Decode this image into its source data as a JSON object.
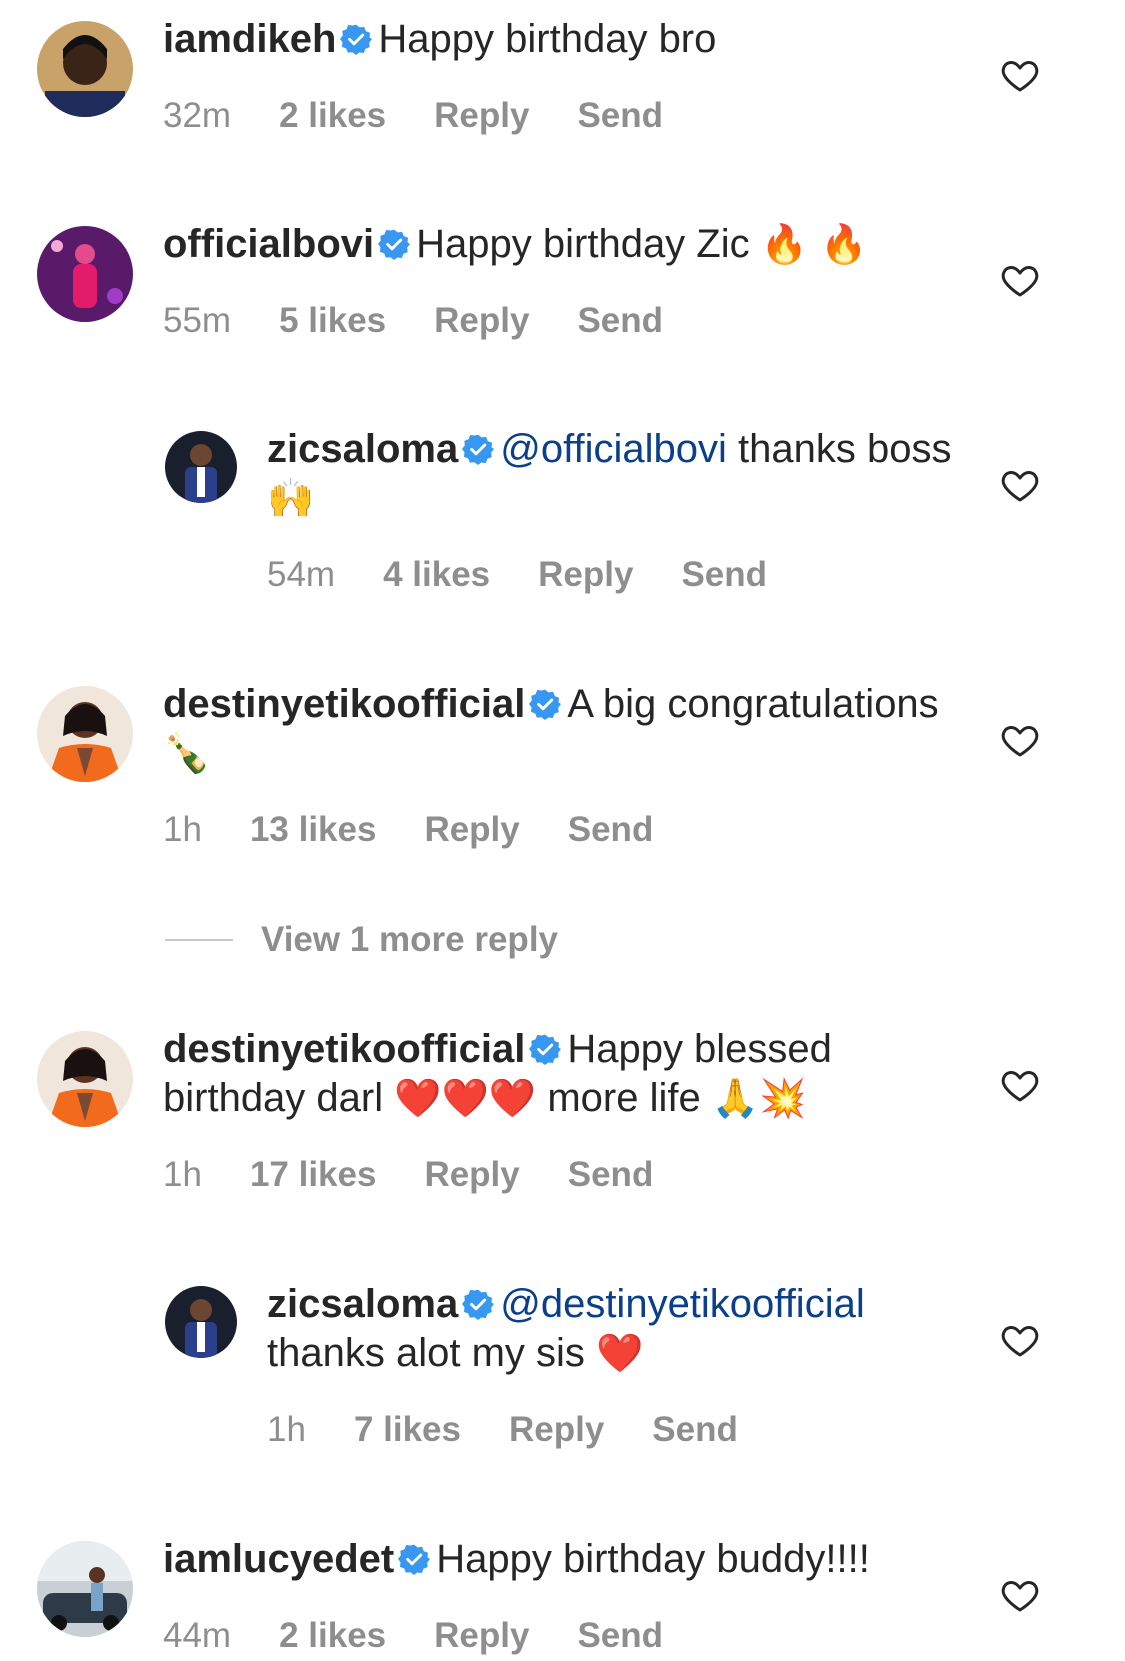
{
  "comments": [
    {
      "username": "iamdikeh",
      "text": "Happy birthday bro",
      "emojis": "",
      "time": "32m",
      "likes": "2 likes",
      "reply": "Reply",
      "send": "Send"
    },
    {
      "username": "officialbovi",
      "text": "Happy birthday Zic",
      "emojis": "🔥 🔥",
      "time": "55m",
      "likes": "5 likes",
      "reply": "Reply",
      "send": "Send"
    },
    {
      "username": "zicsaloma",
      "mention": "@officialbovi",
      "text": "thanks boss",
      "emojis": "🙌",
      "time": "54m",
      "likes": "4 likes",
      "reply": "Reply",
      "send": "Send"
    },
    {
      "username": "destinyetikoofficial",
      "text": "A big congratulations",
      "emojis": "🍾",
      "time": "1h",
      "likes": "13 likes",
      "reply": "Reply",
      "send": "Send"
    },
    {
      "username": "destinyetikoofficial",
      "text": "Happy blessed birthday darl",
      "emojis": "❤️❤️❤️",
      "text2": "more life",
      "emojis2": "🙏💥",
      "time": "1h",
      "likes": "17 likes",
      "reply": "Reply",
      "send": "Send"
    },
    {
      "username": "zicsaloma",
      "mention": "@destinyetikoofficial",
      "text": "thanks alot my sis",
      "emojis": "❤️",
      "time": "1h",
      "likes": "7 likes",
      "reply": "Reply",
      "send": "Send"
    },
    {
      "username": "iamlucyedet",
      "text": "Happy birthday buddy!!!!",
      "emojis": "",
      "time": "44m",
      "likes": "2 likes",
      "reply": "Reply",
      "send": "Send"
    }
  ],
  "view_more_replies": "View 1 more reply",
  "icons": {
    "verified": "verified-badge-icon",
    "like": "heart-outline-icon"
  },
  "colors": {
    "verified_blue": "#3897f0",
    "meta_gray": "#8e8e8e",
    "mention_blue": "#0b3f89"
  }
}
